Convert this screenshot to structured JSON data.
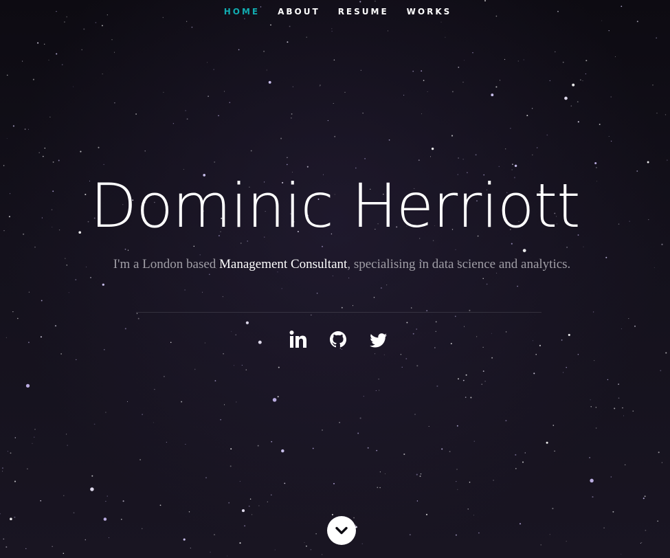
{
  "nav": {
    "items": [
      {
        "label": "HOME",
        "active": true
      },
      {
        "label": "ABOUT",
        "active": false
      },
      {
        "label": "RESUME",
        "active": false
      },
      {
        "label": "WORKS",
        "active": false
      }
    ],
    "active_color": "#11ABB0"
  },
  "hero": {
    "name": "Dominic Herriott",
    "tagline_prefix": "I'm a London based ",
    "tagline_highlight": "Management Consultant",
    "tagline_suffix": ", specialising in data science and analytics."
  },
  "social": [
    {
      "icon": "linkedin-icon"
    },
    {
      "icon": "github-icon"
    },
    {
      "icon": "twitter-icon"
    }
  ],
  "scroll": {
    "icon": "chevron-down-icon"
  }
}
